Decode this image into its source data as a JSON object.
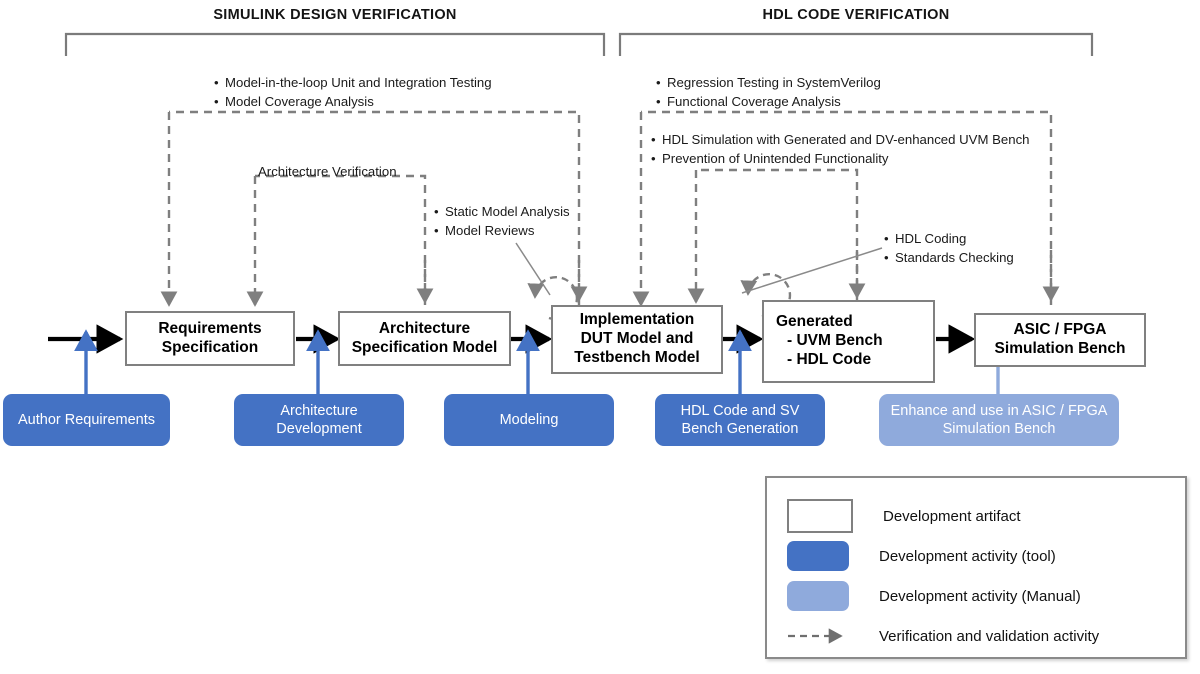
{
  "phases": [
    {
      "title": "Simulink Design Verification"
    },
    {
      "title": "HDL Code Verification"
    }
  ],
  "annotations": {
    "mil": {
      "items": [
        "Model-in-the-loop Unit and Integration Testing",
        "Model Coverage Analysis"
      ]
    },
    "regression": {
      "items": [
        "Regression Testing in SystemVerilog",
        "Functional Coverage Analysis"
      ]
    },
    "hdl_sim": {
      "items": [
        "HDL Simulation with Generated and DV-enhanced UVM Bench",
        "Prevention of Unintended Functionality"
      ]
    },
    "arch_verification": {
      "label": "Architecture Verification"
    },
    "static": {
      "items": [
        "Static Model Analysis",
        "Model Reviews"
      ]
    },
    "coding": {
      "items": [
        "HDL Coding",
        "Standards Checking"
      ]
    }
  },
  "artifacts": [
    {
      "id": "requirements-specification",
      "lines": [
        "Requirements",
        "Specification"
      ]
    },
    {
      "id": "architecture-specification-model",
      "lines": [
        "Architecture",
        "Specification Model"
      ]
    },
    {
      "id": "implementation-dut-model",
      "lines": [
        "Implementation",
        "DUT Model and",
        "Testbench Model"
      ]
    },
    {
      "id": "generated",
      "lines": [
        "Generated",
        "- UVM Bench",
        "- HDL Code"
      ]
    },
    {
      "id": "asic-fpga-simulation-bench",
      "lines": [
        "ASIC / FPGA",
        "Simulation Bench"
      ]
    }
  ],
  "activities": [
    {
      "id": "author-requirements",
      "kind": "tool",
      "lines": [
        "Author",
        "Requirements"
      ]
    },
    {
      "id": "architecture-development",
      "kind": "tool",
      "lines": [
        "Architecture",
        "Development"
      ]
    },
    {
      "id": "modeling",
      "kind": "tool",
      "lines": [
        "Modeling"
      ]
    },
    {
      "id": "hdl-code-sv-bench-generation",
      "kind": "tool",
      "lines": [
        "HDL Code and SV",
        "Bench Generation"
      ]
    },
    {
      "id": "enhance-asic-fpga",
      "kind": "manual",
      "lines": [
        "Enhance and use in ASIC /",
        "FPGA Simulation Bench"
      ]
    }
  ],
  "legend": {
    "rows": [
      {
        "swatch": "artifact",
        "label": "Development  artifact"
      },
      {
        "swatch": "tool",
        "label": "Development  activity (tool)"
      },
      {
        "swatch": "manual",
        "label": "Development  activity (Manual)"
      },
      {
        "swatch": "dashed-arrow",
        "label": "Verification and validation activity"
      }
    ]
  },
  "colors": {
    "tool_blue": "#4472C4",
    "manual_blue": "#8FAADC",
    "artifact_border": "#808080",
    "flow_arrow": "#000000",
    "dashed_arrow": "#7f7f7f",
    "activity_arrow": "#4472C4",
    "manual_arrow": "#8FAADC"
  }
}
